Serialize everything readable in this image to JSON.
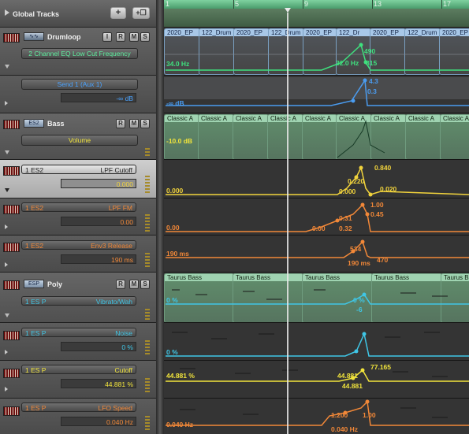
{
  "header": {
    "title": "Global Tracks",
    "add_label": "+",
    "add_folder_label": "+❐"
  },
  "ruler": {
    "bars": [
      "1",
      "5",
      "9",
      "13",
      "17"
    ]
  },
  "tracks": [
    {
      "name": "Drumloop",
      "buttons": [
        "I",
        "R",
        "M",
        "S"
      ],
      "automation": {
        "param": "2 Channel EQ Low Cut Frequency",
        "value_text": "34.0 Hz",
        "points": [
          "490",
          "32.0 Hz",
          "315"
        ]
      },
      "sub": {
        "param": "Send 1 (Aux 1)",
        "value": "-∞ dB",
        "lane_text": "-∞ dB",
        "points": [
          "4.3",
          "0.3"
        ]
      },
      "regions": [
        "2020_EP",
        "122_Drum",
        "2020_EP",
        "122_Drum",
        "2020_EP",
        "122_Dr",
        "2020_EP",
        "122_Drum",
        "2020_EP"
      ]
    },
    {
      "name": "Bass",
      "plugin": "ES2",
      "buttons": [
        "R",
        "M",
        "S"
      ],
      "automation": {
        "param": "Volume",
        "value_text": "-10.0 dB"
      },
      "regions": [
        "Classic A",
        "Classic A",
        "Classic A",
        "Classic A",
        "Classic A",
        "Classic A",
        "Classic A",
        "Classic A",
        "Classic A"
      ],
      "subs": [
        {
          "plugin": "1 ES2",
          "param": "LPF Cutoff",
          "value": "0.000",
          "lane_text": "0.000",
          "points": [
            "0.840",
            "0.220",
            "0.020",
            "0.000"
          ],
          "color": "#f1d33c"
        },
        {
          "plugin": "1 ES2",
          "param": "LPF FM",
          "value": "0.00",
          "lane_text": "0.00",
          "points": [
            "1.00",
            "0.45",
            "0.31",
            "0.32",
            "0.00"
          ],
          "color": "#f28838"
        },
        {
          "plugin": "1 ES2",
          "param": "Env3 Release",
          "value": "190 ms",
          "lane_text": "190 ms",
          "points": [
            "190 ms",
            "470",
            "534"
          ],
          "color": "#f28838"
        }
      ]
    },
    {
      "name": "Poly",
      "plugin": "ESP",
      "buttons": [
        "R",
        "M",
        "S"
      ],
      "regions": [
        "Taurus Bass",
        "Taurus Bass",
        "Taurus Bass",
        "Taurus Bass",
        "Taurus Bass"
      ],
      "subs": [
        {
          "plugin": "1 ES P",
          "param": "Vibrato/Wah",
          "value": "",
          "lane_text": "0 %",
          "points": [
            "0 %",
            "-6"
          ],
          "color": "#3fc6e6"
        },
        {
          "plugin": "1 ES P",
          "param": "Noise",
          "value": "0 %",
          "lane_text": "0 %",
          "points": [],
          "color": "#3fc6e6"
        },
        {
          "plugin": "1 ES P",
          "param": "Cutoff",
          "value": "44.881 %",
          "lane_text": "44.881 %",
          "points": [
            "77.165",
            "44.881",
            "44.881"
          ],
          "color": "#f1e43c"
        },
        {
          "plugin": "1 ES P",
          "param": "LFO Speed",
          "value": "0.040 Hz",
          "lane_text": "0.040 Hz",
          "points": [
            "1.200",
            "1.00",
            "0.040 Hz"
          ],
          "color": "#f28838"
        }
      ]
    }
  ],
  "colors": {
    "green": "#3fe07e",
    "blue": "#4a9cf0",
    "yellow": "#f1d33c",
    "orange": "#f28838",
    "cyan": "#3fc6e6",
    "playhead": "#e8e8e8"
  }
}
